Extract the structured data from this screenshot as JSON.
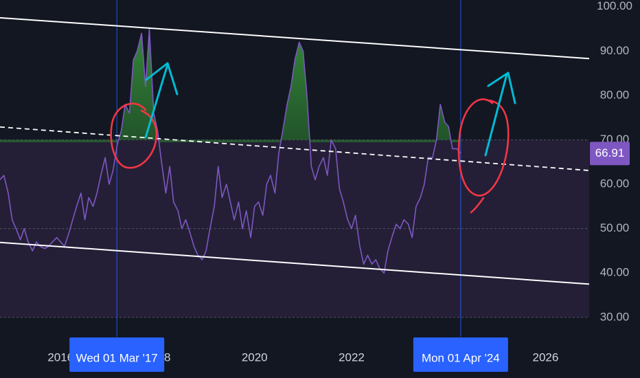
{
  "colors": {
    "background": "#131722",
    "band_fill": "#241f36",
    "rsi_line": "#7e57c2",
    "overbought_fill": "#2e7d32",
    "channel_line": "#ffffff",
    "crosshair": "#2962ff",
    "flag": "#2962ff",
    "circle_annotation": "#f23645",
    "arrow_annotation": "#00bcd4",
    "badge": "#7e57c2"
  },
  "chart_data": {
    "type": "line",
    "title": "",
    "xlabel": "",
    "ylabel": "",
    "x_range": [
      2014.75,
      2026.9
    ],
    "ylim": [
      27.5,
      101.5
    ],
    "y_ticks": [
      {
        "value": 100,
        "label": "100.00"
      },
      {
        "value": 90,
        "label": "90.00"
      },
      {
        "value": 80,
        "label": "80.00"
      },
      {
        "value": 70,
        "label": "70.00"
      },
      {
        "value": 60,
        "label": "60.00"
      },
      {
        "value": 50,
        "label": "50.00"
      },
      {
        "value": 40,
        "label": "40.00"
      },
      {
        "value": 30,
        "label": "30.00"
      }
    ],
    "x_ticks": [
      {
        "value": 2016,
        "label": "2016"
      },
      {
        "value": 2018,
        "label": "2018"
      },
      {
        "value": 2020,
        "label": "2020"
      },
      {
        "value": 2022,
        "label": "2022"
      },
      {
        "value": 2026,
        "label": "2026"
      }
    ],
    "band": {
      "upper": 70,
      "lower": 30
    },
    "reference_levels": [
      50,
      30
    ],
    "overbought_level": 70,
    "series": [
      {
        "values": [
          [
            2014.75,
            61
          ],
          [
            2014.83,
            62
          ],
          [
            2014.92,
            58
          ],
          [
            2015.0,
            52
          ],
          [
            2015.08,
            50
          ],
          [
            2015.17,
            47.5
          ],
          [
            2015.25,
            50
          ],
          [
            2015.33,
            47
          ],
          [
            2015.42,
            45
          ],
          [
            2015.5,
            47
          ],
          [
            2015.58,
            46
          ],
          [
            2015.67,
            45.5
          ],
          [
            2015.75,
            46
          ],
          [
            2015.83,
            47
          ],
          [
            2015.92,
            48
          ],
          [
            2016.0,
            47
          ],
          [
            2016.08,
            46
          ],
          [
            2016.17,
            49
          ],
          [
            2016.25,
            52
          ],
          [
            2016.33,
            55
          ],
          [
            2016.42,
            58
          ],
          [
            2016.5,
            52
          ],
          [
            2016.58,
            57
          ],
          [
            2016.67,
            55
          ],
          [
            2016.75,
            58
          ],
          [
            2016.83,
            62
          ],
          [
            2016.92,
            66
          ],
          [
            2017.0,
            60
          ],
          [
            2017.08,
            63
          ],
          [
            2017.17,
            69
          ],
          [
            2017.25,
            72
          ],
          [
            2017.33,
            78
          ],
          [
            2017.42,
            76
          ],
          [
            2017.5,
            88
          ],
          [
            2017.58,
            90
          ],
          [
            2017.67,
            94
          ],
          [
            2017.75,
            82
          ],
          [
            2017.83,
            95
          ],
          [
            2017.92,
            76
          ],
          [
            2018.0,
            72
          ],
          [
            2018.08,
            65
          ],
          [
            2018.17,
            58
          ],
          [
            2018.25,
            64
          ],
          [
            2018.33,
            56
          ],
          [
            2018.42,
            54
          ],
          [
            2018.5,
            50
          ],
          [
            2018.58,
            52
          ],
          [
            2018.67,
            49
          ],
          [
            2018.75,
            46
          ],
          [
            2018.83,
            44
          ],
          [
            2018.92,
            43
          ],
          [
            2019.0,
            45
          ],
          [
            2019.08,
            50
          ],
          [
            2019.17,
            55
          ],
          [
            2019.25,
            64
          ],
          [
            2019.33,
            57
          ],
          [
            2019.42,
            60
          ],
          [
            2019.5,
            56
          ],
          [
            2019.58,
            52
          ],
          [
            2019.67,
            56
          ],
          [
            2019.75,
            50
          ],
          [
            2019.83,
            54
          ],
          [
            2019.92,
            48
          ],
          [
            2020.0,
            55
          ],
          [
            2020.08,
            56
          ],
          [
            2020.17,
            53
          ],
          [
            2020.25,
            60
          ],
          [
            2020.33,
            62
          ],
          [
            2020.42,
            58
          ],
          [
            2020.5,
            67
          ],
          [
            2020.58,
            72
          ],
          [
            2020.67,
            78
          ],
          [
            2020.75,
            82
          ],
          [
            2020.83,
            88
          ],
          [
            2020.92,
            92
          ],
          [
            2021.0,
            90
          ],
          [
            2021.08,
            80
          ],
          [
            2021.17,
            64
          ],
          [
            2021.25,
            61
          ],
          [
            2021.33,
            64
          ],
          [
            2021.42,
            66
          ],
          [
            2021.5,
            62
          ],
          [
            2021.58,
            70
          ],
          [
            2021.67,
            68
          ],
          [
            2021.75,
            59
          ],
          [
            2021.83,
            56
          ],
          [
            2021.92,
            52
          ],
          [
            2022.0,
            50
          ],
          [
            2022.08,
            53
          ],
          [
            2022.17,
            46
          ],
          [
            2022.25,
            42
          ],
          [
            2022.33,
            44
          ],
          [
            2022.42,
            42
          ],
          [
            2022.5,
            43
          ],
          [
            2022.58,
            41
          ],
          [
            2022.67,
            40
          ],
          [
            2022.75,
            45
          ],
          [
            2022.83,
            48
          ],
          [
            2022.92,
            51
          ],
          [
            2023.0,
            50
          ],
          [
            2023.08,
            52
          ],
          [
            2023.17,
            51
          ],
          [
            2023.25,
            48
          ],
          [
            2023.33,
            55
          ],
          [
            2023.42,
            57
          ],
          [
            2023.5,
            60
          ],
          [
            2023.58,
            66
          ],
          [
            2023.67,
            66
          ],
          [
            2023.75,
            70
          ],
          [
            2023.83,
            78
          ],
          [
            2023.92,
            74
          ],
          [
            2024.0,
            73
          ],
          [
            2024.08,
            68
          ],
          [
            2024.17,
            68
          ],
          [
            2024.25,
            67
          ]
        ]
      }
    ],
    "channel_lines": [
      {
        "style": "solid",
        "points": [
          [
            2014.75,
            97.5
          ],
          [
            2026.9,
            88.3
          ]
        ]
      },
      {
        "style": "solid",
        "points": [
          [
            2014.75,
            46.9
          ],
          [
            2026.9,
            37.5
          ]
        ]
      },
      {
        "style": "dashed",
        "points": [
          [
            2014.75,
            72.9
          ],
          [
            2026.9,
            63.1
          ]
        ]
      }
    ],
    "crosshairs": [
      {
        "x": 2017.16,
        "label": "Wed 01 Mar '17"
      },
      {
        "x": 2024.25,
        "label": "Mon 01 Apr '24"
      }
    ],
    "last_value": {
      "value": 66.91,
      "label": "66.91"
    }
  }
}
